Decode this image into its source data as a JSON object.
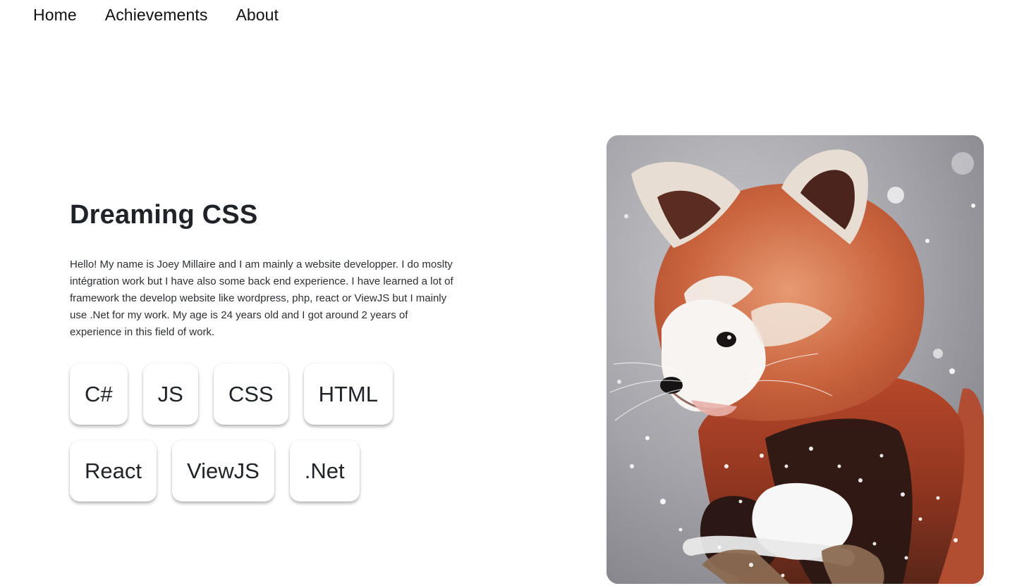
{
  "nav": {
    "items": [
      {
        "label": "Home"
      },
      {
        "label": "Achievements"
      },
      {
        "label": "About"
      }
    ]
  },
  "hero": {
    "title": "Dreaming CSS",
    "bio": "Hello! My name is Joey Millaire and I am mainly a website developper. I do moslty intégration work but I have also some back end experience. I have learned a lot of framework the develop website like wordpress, php, react or ViewJS but I mainly use .Net for my work. My age is 24 years old and I got around 2 years of experience in this field of work.",
    "skills_row1": [
      "C#",
      "JS",
      "CSS",
      "HTML"
    ],
    "skills_row2": [
      "React",
      "ViewJS",
      ".Net"
    ]
  },
  "image": {
    "subject": "red panda in snow"
  },
  "colors": {
    "text": "#212529",
    "background": "#ffffff",
    "panda_fur": "#b44a2b"
  }
}
